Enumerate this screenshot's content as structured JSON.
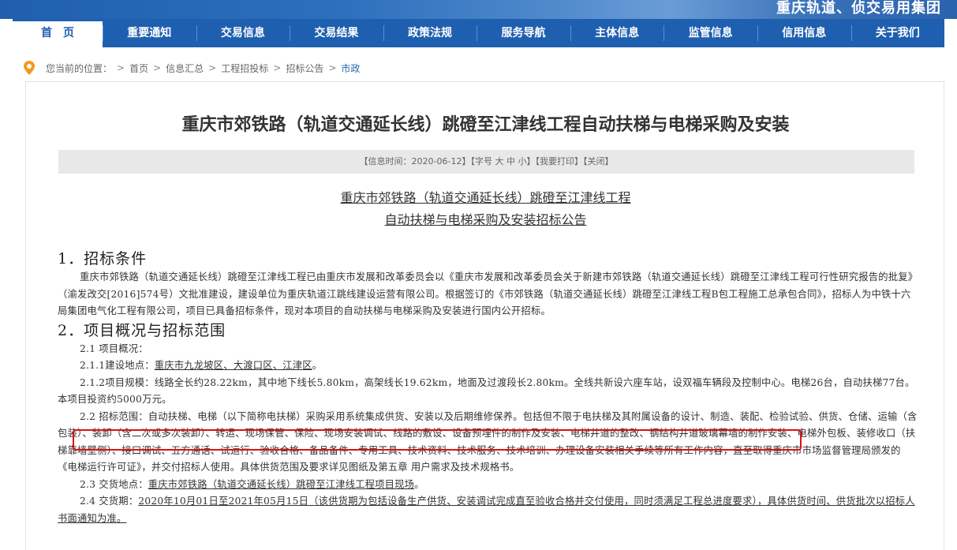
{
  "banner": {
    "text": "重庆轨道、侦交易用集团"
  },
  "nav": {
    "items": [
      {
        "label": "首　页"
      },
      {
        "label": "重要通知"
      },
      {
        "label": "交易信息"
      },
      {
        "label": "交易结果"
      },
      {
        "label": "政策法规"
      },
      {
        "label": "服务导航"
      },
      {
        "label": "主体信息"
      },
      {
        "label": "监管信息"
      },
      {
        "label": "信用信息"
      },
      {
        "label": "关于我们"
      }
    ]
  },
  "breadcrumb": {
    "prefix": "您当前的位置：",
    "items": [
      "首页",
      "信息汇总",
      "工程招投标",
      "招标公告",
      "市政"
    ]
  },
  "article": {
    "title": "重庆市郊铁路（轨道交通延长线）跳磴至江津线工程自动扶梯与电梯采购及安装",
    "info": "【信息时间：2020-06-12】【字号 大 中 小】【我要打印】【关闭】",
    "doc_title_1": "重庆市郊铁路（轨道交通延长线）跳磴至江津线工程",
    "doc_title_2": "自动扶梯与电梯采购及安装招标公告",
    "h1": "1．招标条件",
    "p1": "重庆市郊铁路（轨道交通延长线）跳磴至江津线工程已由重庆市发展和改革委员会以《重庆市发展和改革委员会关于新建市郊铁路（轨道交通延长线）跳磴至江津线工程可行性研究报告的批复》（渝发改交[2016]574号）文批准建设，建设单位为重庆轨道江跳线建设运营有限公司。根据签订的《市郊铁路（轨道交通延长线）跳磴至江津线工程B包工程施工总承包合同》，招标人为中铁十六局集团电气化工程有限公司，项目已具备招标条件，现对本项目的自动扶梯与电梯采购及安装进行国内公开招标。",
    "h2": "2．项目概况与招标范围",
    "p2_1": "2.1 项目概况：",
    "p2_1_1_label": "2.1.1建设地点：",
    "p2_1_1_value": "重庆市九龙坡区、大渡口区、江津区",
    "p2_1_1_end": "。",
    "p2_1_2": "2.1.2项目规模：线路全长约28.22km，其中地下线长5.80km，高架线长19.62km，地面及过渡段长2.80km。全线共新设六座车站，设双福车辆段及控制中心。电梯26台，自动扶梯77台。本项目投资约5000万元。",
    "p2_2": "2.2 招标范围：自动扶梯、电梯（以下简称电扶梯）采购采用系统集成供货、安装以及后期维修保养。包括但不限于电扶梯及其附属设备的设计、制造、装配、检验试验、供货、仓储、运输（含包装）、装卸（含二次或多次装卸）、转运、现场保管、保险、现场安装调试、线路的敷设、设备预埋件的制作及安装、电梯井道的整改、钢结构井道玻璃幕墙的制作安装、电梯外包板、装修收口（扶梯靠墙壁侧）、接口调试、五方通话、试运行、验收合格、备品备件、专用工具、技术资料、技术服务、技术培训、办理设备安装相关手续等所有工作内容，直至取得重庆市市场监督管理局颁发的《电梯运行许可证》，并交付招标人使用。具体供货范围及要求详见图纸及第五章 用户需求及技术规格书。",
    "p2_3_label": "2.3 交货地点：",
    "p2_3_value": "重庆市郊铁路（轨道交通延长线）跳磴至江津线工程项目现场",
    "p2_3_end": "。",
    "p2_4_label": "2.4 交货期：",
    "p2_4_value": "2020年10月01日至2021年05月15日（该供货期为包括设备生产供货、安装调试完成直至验收合格并交付使用，同时须满足工程总进度要求），具体供货时间、供货批次以招标人书面通知为准。"
  }
}
